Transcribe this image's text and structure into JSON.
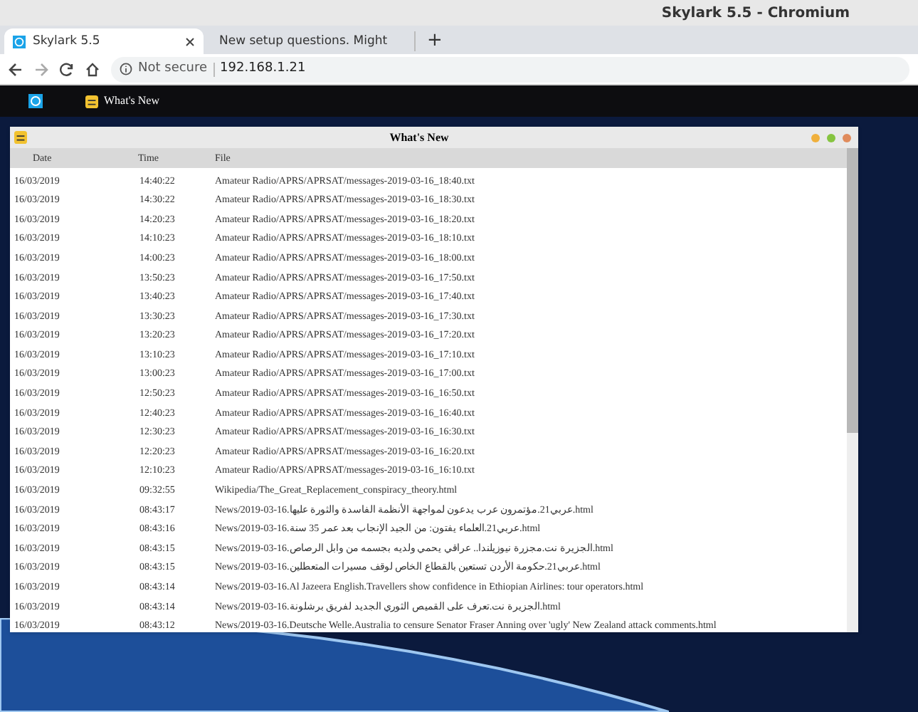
{
  "browser": {
    "window_title": "Skylark 5.5 - Chromium",
    "tabs": [
      {
        "title": "Skylark 5.5",
        "selected": true,
        "kind": "app"
      },
      {
        "title": "New setup questions. Might",
        "selected": false,
        "kind": "page"
      }
    ],
    "new_tab": "+",
    "address": {
      "security": "Not secure",
      "url": "192.168.1.21"
    }
  },
  "taskbar": {
    "app_label": "What's New"
  },
  "window": {
    "title": "What's New",
    "columns": [
      "Date",
      "Time",
      "File"
    ],
    "rows": [
      [
        "16/03/2019",
        "14:40:22",
        "Amateur Radio/APRS/APRSAT/messages-2019-03-16_18:40.txt"
      ],
      [
        "16/03/2019",
        "14:30:22",
        "Amateur Radio/APRS/APRSAT/messages-2019-03-16_18:30.txt"
      ],
      [
        "16/03/2019",
        "14:20:23",
        "Amateur Radio/APRS/APRSAT/messages-2019-03-16_18:20.txt"
      ],
      [
        "16/03/2019",
        "14:10:23",
        "Amateur Radio/APRS/APRSAT/messages-2019-03-16_18:10.txt"
      ],
      [
        "16/03/2019",
        "14:00:23",
        "Amateur Radio/APRS/APRSAT/messages-2019-03-16_18:00.txt"
      ],
      [
        "16/03/2019",
        "13:50:23",
        "Amateur Radio/APRS/APRSAT/messages-2019-03-16_17:50.txt"
      ],
      [
        "16/03/2019",
        "13:40:23",
        "Amateur Radio/APRS/APRSAT/messages-2019-03-16_17:40.txt"
      ],
      [
        "16/03/2019",
        "13:30:23",
        "Amateur Radio/APRS/APRSAT/messages-2019-03-16_17:30.txt"
      ],
      [
        "16/03/2019",
        "13:20:23",
        "Amateur Radio/APRS/APRSAT/messages-2019-03-16_17:20.txt"
      ],
      [
        "16/03/2019",
        "13:10:23",
        "Amateur Radio/APRS/APRSAT/messages-2019-03-16_17:10.txt"
      ],
      [
        "16/03/2019",
        "13:00:23",
        "Amateur Radio/APRS/APRSAT/messages-2019-03-16_17:00.txt"
      ],
      [
        "16/03/2019",
        "12:50:23",
        "Amateur Radio/APRS/APRSAT/messages-2019-03-16_16:50.txt"
      ],
      [
        "16/03/2019",
        "12:40:23",
        "Amateur Radio/APRS/APRSAT/messages-2019-03-16_16:40.txt"
      ],
      [
        "16/03/2019",
        "12:30:23",
        "Amateur Radio/APRS/APRSAT/messages-2019-03-16_16:30.txt"
      ],
      [
        "16/03/2019",
        "12:20:23",
        "Amateur Radio/APRS/APRSAT/messages-2019-03-16_16:20.txt"
      ],
      [
        "16/03/2019",
        "12:10:23",
        "Amateur Radio/APRS/APRSAT/messages-2019-03-16_16:10.txt"
      ],
      [
        "16/03/2019",
        "09:32:55",
        "Wikipedia/The_Great_Replacement_conspiracy_theory.html"
      ],
      [
        "16/03/2019",
        "08:43:17",
        "News/2019-03-16.عربي21.مؤتمرون عرب يدعون لمواجهة الأنظمة الفاسدة والثورة عليها.html"
      ],
      [
        "16/03/2019",
        "08:43:16",
        "News/2019-03-16.عربي21.العلماء يفتون: من الجيد الإنجاب بعد عمر 35 سنة.html"
      ],
      [
        "16/03/2019",
        "08:43:15",
        "News/2019-03-16.الجزيرة نت.مجزرة نيوزيلندا.. عراقي يحمي ولديه بجسمه من وابل الرصاص.html"
      ],
      [
        "16/03/2019",
        "08:43:15",
        "News/2019-03-16.عربي21.حكومة الأردن تستعين بالقطاع الخاص لوقف مسيرات المتعطلين.html"
      ],
      [
        "16/03/2019",
        "08:43:14",
        "News/2019-03-16.Al Jazeera English.Travellers show confidence in Ethiopian Airlines: tour operators.html"
      ],
      [
        "16/03/2019",
        "08:43:14",
        "News/2019-03-16.الجزيرة نت.تعرف على القميص الثوري الجديد لفريق برشلونة.html"
      ],
      [
        "16/03/2019",
        "08:43:12",
        "News/2019-03-16.Deutsche Welle.Australia to censure Senator Fraser Anning over 'ugly' New Zealand attack comments.html"
      ]
    ]
  }
}
